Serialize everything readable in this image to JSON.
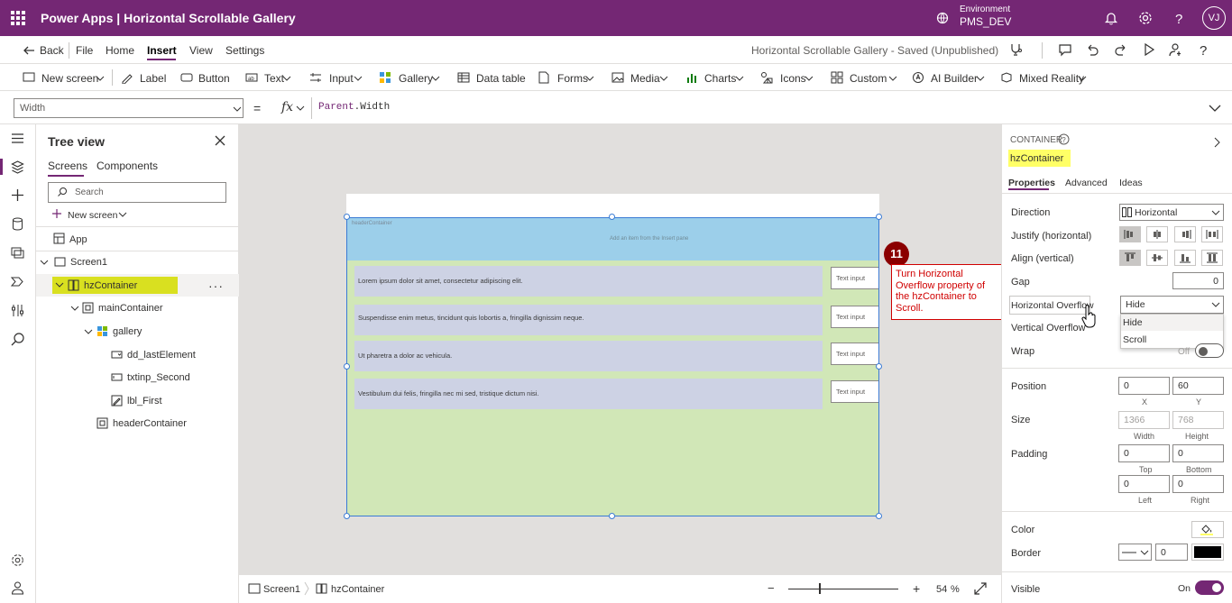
{
  "topbar": {
    "title": "Power Apps  |  Horizontal Scrollable Gallery",
    "env_label": "Environment",
    "env_value": "PMS_DEV",
    "avatar": "VJ",
    "icons": [
      "waffle-icon",
      "environment-icon",
      "bell-icon",
      "settings-icon",
      "help-icon"
    ]
  },
  "menubar": {
    "back": "Back",
    "items": [
      "File",
      "Home",
      "Insert",
      "View",
      "Settings"
    ],
    "active": "Insert",
    "save_status": "Horizontal Scrollable Gallery - Saved (Unpublished)"
  },
  "ribbon": {
    "items": [
      "New screen",
      "Label",
      "Button",
      "Text",
      "Input",
      "Gallery",
      "Data table",
      "Forms",
      "Media",
      "Charts",
      "Icons",
      "Custom",
      "AI Builder",
      "Mixed Reality"
    ]
  },
  "formula": {
    "property": "Width",
    "eq": "=",
    "fx": "fx",
    "kw": "Parent",
    "rest": ".Width"
  },
  "treeview": {
    "title": "Tree view",
    "tabs": [
      "Screens",
      "Components"
    ],
    "search_placeholder": "Search",
    "new_screen": "New screen",
    "nodes": {
      "app": "App",
      "screen1": "Screen1",
      "hzContainer": "hzContainer",
      "mainContainer": "mainContainer",
      "gallery": "gallery",
      "dd_lastElement": "dd_lastElement",
      "txtinp_Second": "txtinp_Second",
      "lbl_First": "lbl_First",
      "headerContainer": "headerContainer"
    },
    "more": "···"
  },
  "canvas": {
    "header_label": "headerContainer",
    "header_add": "Add an item from the Insert pane",
    "rows": [
      "Lorem ipsum dolor sit amet, consectetur adipiscing elit.",
      "Suspendisse enim metus, tincidunt quis lobortis a, fringilla dignissim neque.",
      "Ut pharetra a dolor ac vehicula.",
      "Vestibulum dui felis, fringilla nec mi sed, tristique dictum nisi."
    ],
    "input_text": "Text input"
  },
  "annotation": {
    "step": "11",
    "text": "Turn Horizontal Overflow property of the hzContainer to Scroll."
  },
  "statusbar": {
    "screen": "Screen1",
    "container": "hzContainer",
    "zoom_minus": "−",
    "zoom_plus": "+",
    "zoom_value": "54",
    "zoom_unit": "%"
  },
  "properties": {
    "type": "CONTAINER",
    "name": "hzContainer",
    "tabs": [
      "Properties",
      "Advanced",
      "Ideas"
    ],
    "direction_label": "Direction",
    "direction_value": "Horizontal",
    "justify_label": "Justify (horizontal)",
    "align_label": "Align (vertical)",
    "gap_label": "Gap",
    "gap_value": "0",
    "ho_label": "Horizontal Overflow",
    "ho_value": "Hide",
    "ho_options": [
      "Hide",
      "Scroll"
    ],
    "vo_label": "Vertical Overflow",
    "wrap_label": "Wrap",
    "wrap_value": "Off",
    "position_label": "Position",
    "x": "0",
    "y": "60",
    "x_label": "X",
    "y_label": "Y",
    "size_label": "Size",
    "width": "1366",
    "height": "768",
    "width_label": "Width",
    "height_label": "Height",
    "padding_label": "Padding",
    "pad_top": "0",
    "pad_bottom": "0",
    "pad_left": "0",
    "pad_right": "0",
    "top_label": "Top",
    "bottom_label": "Bottom",
    "left_label": "Left",
    "right_label": "Right",
    "color_label": "Color",
    "border_label": "Border",
    "border_width": "0",
    "visible_label": "Visible",
    "visible_value": "On"
  },
  "colors": {
    "brand": "#742774",
    "highlight": "#d9e020",
    "header_container": "#9ccfea",
    "main_container": "#d1e7b7",
    "annotation": "#d00000"
  }
}
